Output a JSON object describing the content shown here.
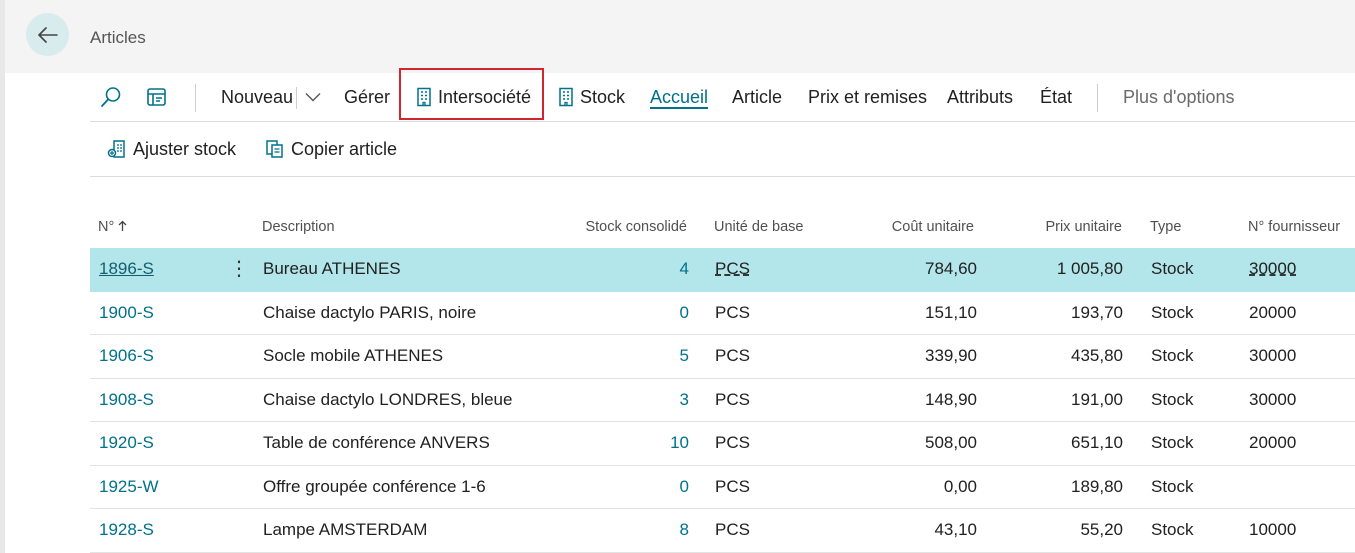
{
  "page": {
    "title": "Articles"
  },
  "actionbar": {
    "new_label": "Nouveau",
    "manage_label": "Gérer",
    "intercompany_label": "Intersociété",
    "stock_label": "Stock",
    "home_label": "Accueil",
    "item_label": "Article",
    "prices_label": "Prix et remises",
    "attributes_label": "Attributs",
    "state_label": "État",
    "more_label": "Plus d'options"
  },
  "subactions": {
    "adjust_label": "Ajuster stock",
    "copy_label": "Copier article"
  },
  "table": {
    "headers": {
      "no": "N°",
      "description": "Description",
      "stock": "Stock consolidé",
      "unit": "Unité de base",
      "cost": "Coût unitaire",
      "price": "Prix unitaire",
      "type": "Type",
      "vendor": "N° fournisseur"
    },
    "rows": [
      {
        "no": "1896-S",
        "description": "Bureau ATHENES",
        "stock": "4",
        "unit": "PCS",
        "cost": "784,60",
        "price": "1 005,80",
        "type": "Stock",
        "vendor": "30000"
      },
      {
        "no": "1900-S",
        "description": "Chaise dactylo PARIS, noire",
        "stock": "0",
        "unit": "PCS",
        "cost": "151,10",
        "price": "193,70",
        "type": "Stock",
        "vendor": "20000"
      },
      {
        "no": "1906-S",
        "description": "Socle mobile ATHENES",
        "stock": "5",
        "unit": "PCS",
        "cost": "339,90",
        "price": "435,80",
        "type": "Stock",
        "vendor": "30000"
      },
      {
        "no": "1908-S",
        "description": "Chaise dactylo LONDRES, bleue",
        "stock": "3",
        "unit": "PCS",
        "cost": "148,90",
        "price": "191,00",
        "type": "Stock",
        "vendor": "30000"
      },
      {
        "no": "1920-S",
        "description": "Table de conférence ANVERS",
        "stock": "10",
        "unit": "PCS",
        "cost": "508,00",
        "price": "651,10",
        "type": "Stock",
        "vendor": "20000"
      },
      {
        "no": "1925-W",
        "description": "Offre groupée conférence 1-6",
        "stock": "0",
        "unit": "PCS",
        "cost": "0,00",
        "price": "189,80",
        "type": "Stock",
        "vendor": ""
      },
      {
        "no": "1928-S",
        "description": "Lampe AMSTERDAM",
        "stock": "8",
        "unit": "PCS",
        "cost": "43,10",
        "price": "55,20",
        "type": "Stock",
        "vendor": "10000"
      }
    ]
  },
  "colors": {
    "accent": "#00728a",
    "selected_row": "#b2e6ea",
    "highlight_box": "#d0262d"
  }
}
